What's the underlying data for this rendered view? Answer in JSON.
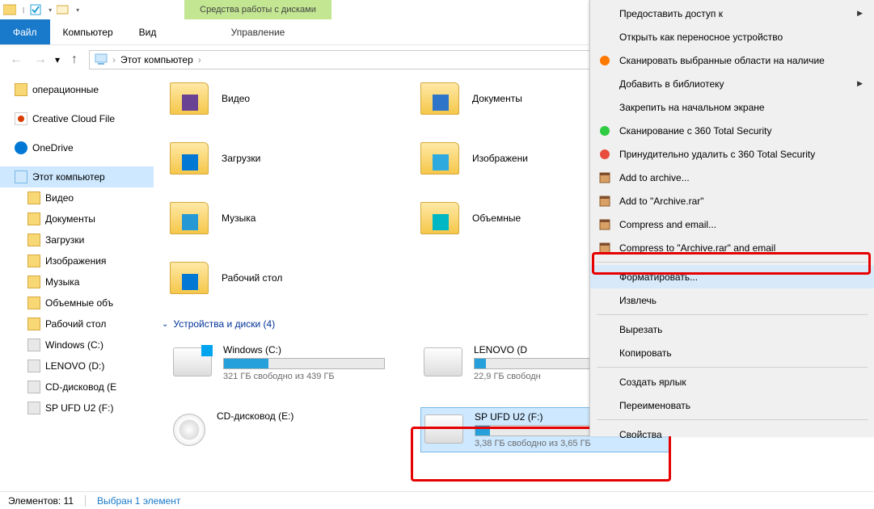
{
  "window": {
    "title": "Этот компьютер"
  },
  "ribbon": {
    "file": "Файл",
    "computer": "Компьютер",
    "view": "Вид",
    "contextual_label": "Средства работы с дисками",
    "contextual_tab": "Управление"
  },
  "address": {
    "root": "Этот компьютер"
  },
  "sidebar": {
    "items": [
      {
        "label": "операционные",
        "icon": "folder"
      },
      {
        "label": "Creative Cloud File",
        "icon": "cc"
      },
      {
        "label": "OneDrive",
        "icon": "cloud"
      },
      {
        "label": "Этот компьютер",
        "icon": "pc",
        "selected": true
      },
      {
        "label": "Видео",
        "icon": "folder"
      },
      {
        "label": "Документы",
        "icon": "folder"
      },
      {
        "label": "Загрузки",
        "icon": "folder"
      },
      {
        "label": "Изображения",
        "icon": "folder"
      },
      {
        "label": "Музыка",
        "icon": "folder"
      },
      {
        "label": "Объемные объ",
        "icon": "folder"
      },
      {
        "label": "Рабочий стол",
        "icon": "folder"
      },
      {
        "label": "Windows (C:)",
        "icon": "drive"
      },
      {
        "label": "LENOVO (D:)",
        "icon": "drive"
      },
      {
        "label": "CD-дисковод (E",
        "icon": "drive"
      },
      {
        "label": "SP UFD U2 (F:)",
        "icon": "drive"
      }
    ]
  },
  "content": {
    "folders": [
      {
        "label": "Видео",
        "overlay": "film"
      },
      {
        "label": "Документы",
        "overlay": "doc"
      },
      {
        "label": "Загрузки",
        "overlay": "down"
      },
      {
        "label": "Изображени",
        "overlay": "pic"
      },
      {
        "label": "Музыка",
        "overlay": "note"
      },
      {
        "label": "Объемные",
        "overlay": "3d"
      },
      {
        "label": "Рабочий стол",
        "overlay": "desk"
      }
    ],
    "section": {
      "label": "Устройства и диски (4)"
    },
    "drives": [
      {
        "name": "Windows (C:)",
        "free": "321 ГБ свободно из 439 ГБ",
        "fill": 28,
        "type": "win"
      },
      {
        "name": "LENOVO (D",
        "free": "22,9 ГБ свободн",
        "fill": 7,
        "type": "hdd"
      },
      {
        "name": "CD-дисковод (E:)",
        "free": "",
        "fill": 0,
        "type": "cd",
        "nobar": true
      },
      {
        "name": "SP UFD U2 (F:)",
        "free": "3,38 ГБ свободно из 3,65 ГБ",
        "fill": 9,
        "type": "usb",
        "selected": true
      }
    ]
  },
  "ctxmenu": {
    "items": [
      {
        "label": "Предоставить доступ к",
        "icon": "",
        "submenu": true
      },
      {
        "label": "Открыть как переносное устройство",
        "icon": ""
      },
      {
        "label": "Сканировать выбранные области на наличие",
        "icon": "avast"
      },
      {
        "label": "Добавить в библиотеку",
        "icon": "",
        "submenu": true
      },
      {
        "label": "Закрепить на начальном экране",
        "icon": ""
      },
      {
        "label": "Сканирование с 360 Total Security",
        "icon": "360g"
      },
      {
        "label": "Принудительно удалить с  360 Total Security",
        "icon": "360r"
      },
      {
        "label": "Add to archive...",
        "icon": "rar"
      },
      {
        "label": "Add to \"Archive.rar\"",
        "icon": "rar"
      },
      {
        "label": "Compress and email...",
        "icon": "rar"
      },
      {
        "label": "Compress to \"Archive.rar\" and email",
        "icon": "rar"
      },
      {
        "sep": true
      },
      {
        "label": "Форматировать...",
        "icon": "",
        "highlight": true
      },
      {
        "label": "Извлечь",
        "icon": ""
      },
      {
        "sep": true
      },
      {
        "label": "Вырезать",
        "icon": ""
      },
      {
        "label": "Копировать",
        "icon": ""
      },
      {
        "sep": true
      },
      {
        "label": "Создать ярлык",
        "icon": ""
      },
      {
        "label": "Переименовать",
        "icon": ""
      },
      {
        "sep": true
      },
      {
        "label": "Свойства",
        "icon": ""
      }
    ]
  },
  "statusbar": {
    "count": "Элементов: 11",
    "selection": "Выбран 1 элемент"
  }
}
